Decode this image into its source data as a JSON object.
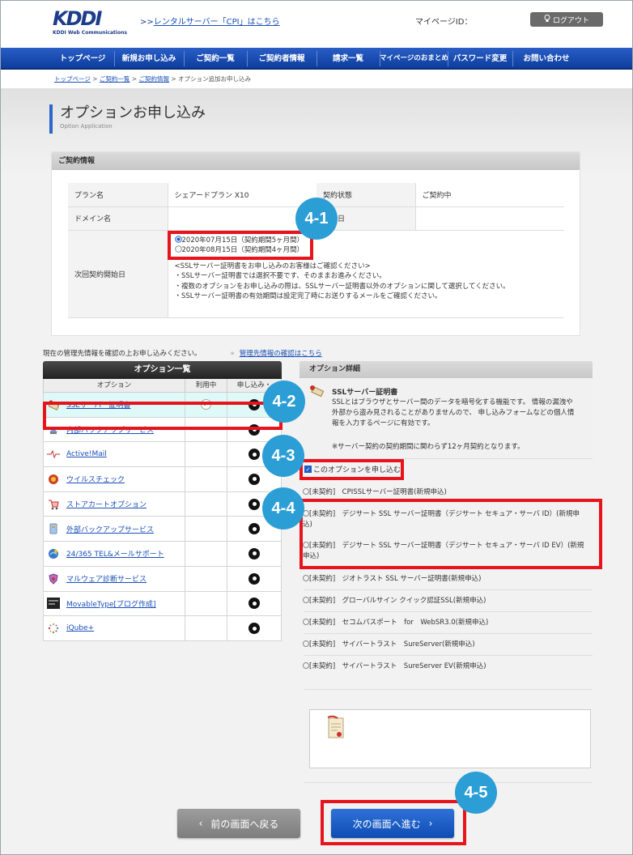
{
  "header": {
    "logo": "KDDI",
    "logo_sub": "KDDI Web Communications",
    "rental_prefix": ">>",
    "rental_link": "レンタルサーバー「CPI」はこちら",
    "mypage_label": "マイページID：",
    "logout_label": "ログアウト"
  },
  "nav": [
    "トップページ",
    "新規お申し込み",
    "ご契約一覧",
    "ご契約者情報",
    "請求一覧",
    "マイページのおまとめ",
    "パスワード変更",
    "お問い合わせ"
  ],
  "breadcrumb": {
    "items": [
      "トップページ",
      "ご契約一覧",
      "ご契約情報"
    ],
    "sep": " > ",
    "current": "オプション追加お申し込み"
  },
  "page": {
    "title": "オプションお申し込み",
    "title_en": "Option Application"
  },
  "contract": {
    "heading": "ご契約情報",
    "plan_label": "プラン名",
    "plan_value": "シェアードプラン X10",
    "status_label": "契約状態",
    "status_value": "ご契約中",
    "domain_label": "ドメイン名",
    "start_label": "開始日",
    "next_label": "次回契約開始日",
    "options": [
      "2020年07月15日（契約期間5ヶ月間）",
      "2020年08月15日（契約期間4ヶ月間）"
    ],
    "notes": [
      "<SSLサーバー証明書をお申し込みのお客様はご確認ください>",
      "・SSLサーバー証明書では選択不要です、そのままお進みください。",
      "・複数のオプションをお申し込みの際は、SSLサーバー証明書以外のオプションに関して選択してください。",
      "・SSLサーバー証明書の有効期間は設定完了時にお送りするメールをご確認ください。"
    ]
  },
  "info": {
    "text": "現在の管理先情報を確認の上お申し込みください。",
    "arrow": "»",
    "link": "管理先情報の確認はこちら"
  },
  "option_list": {
    "heading": "オプション一覧",
    "col_option": "オプション",
    "col_in_use": "利用中",
    "col_apply": "申し込み・",
    "items": [
      {
        "name": "SSLサーバー証明書",
        "icon": "certificate-icon",
        "in_use": "✓"
      },
      {
        "name": "内部バックアップサービス",
        "icon": "backup-icon",
        "in_use": ""
      },
      {
        "name": "Active!Mail",
        "icon": "mail-icon",
        "in_use": ""
      },
      {
        "name": "ウイルスチェック",
        "icon": "virus-icon",
        "in_use": ""
      },
      {
        "name": "ストアカートオプション",
        "icon": "cart-icon",
        "in_use": ""
      },
      {
        "name": "外部バックアップサービス",
        "icon": "external-backup-icon",
        "in_use": ""
      },
      {
        "name": "24/365 TEL&メールサポート",
        "icon": "support-icon",
        "in_use": ""
      },
      {
        "name": "マルウェア診断サービス",
        "icon": "malware-icon",
        "in_use": ""
      },
      {
        "name": "MovableType[ブログ作成]",
        "icon": "movabletype-icon",
        "in_use": ""
      },
      {
        "name": "iQube+",
        "icon": "iqube-icon",
        "in_use": ""
      }
    ]
  },
  "detail": {
    "heading": "オプション詳細",
    "ssl_title": "SSLサーバー証明書",
    "ssl_desc": "SSLとはブラウザとサーバー間のデータを暗号化する機能です。 情報の漏洩や外部から盗み見されることがありませんので、 申し込みフォームなどの個人情報を入力するページに有効です。",
    "ssl_note": "※サーバー契約の契約期間に関わらず12ヶ月契約となります。",
    "apply_label": "このオプションを申し込む",
    "certs": [
      "[未契約]　CPISSLサーバー証明書(新規申込)",
      "[未契約]　デジサート SSL サーバー証明書（デジサート セキュア・サーバ ID）(新規申込)",
      "[未契約]　デジサート SSL サーバー証明書（デジサート セキュア・サーバ ID EV）(新規申込)",
      "[未契約]　ジオトラスト SSL サーバー証明書(新規申込)",
      "[未契約]　グローバルサイン クイック認証SSL(新規申込)",
      "[未契約]　セコムパスポート　for　WebSR3.0(新規申込)",
      "[未契約]　サイバートラスト　SureServer(新規申込)",
      "[未契約]　サイバートラスト　SureServer EV(新規申込)"
    ]
  },
  "buttons": {
    "back": "前の画面へ戻る",
    "next": "次の画面へ進む",
    "back_arrow": "‹",
    "next_arrow": "›"
  },
  "badges": [
    "4-1",
    "4-2",
    "4-3",
    "4-4",
    "4-5"
  ],
  "colors": {
    "nav": "#1a4fb8",
    "highlight": "#e8141c",
    "badge": "#2c9ed6"
  }
}
